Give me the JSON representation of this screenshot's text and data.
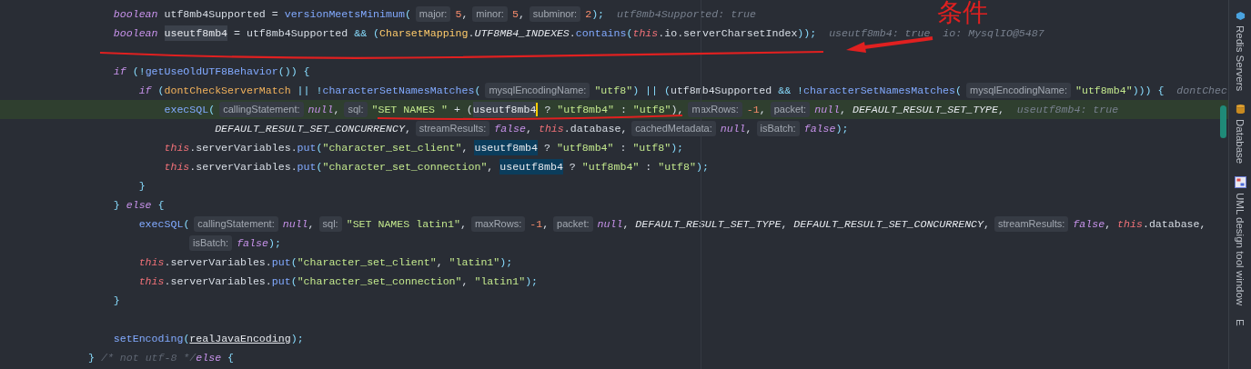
{
  "editor": {
    "lines": [
      {
        "kind": "code",
        "current": false,
        "tokens": [
          {
            "kind": "keyword",
            "text": "    boolean"
          },
          {
            "kind": "ident",
            "text": " utf8mb4Supported = "
          },
          {
            "kind": "method",
            "text": "versionMeetsMinimum"
          },
          {
            "kind": "punct",
            "text": "("
          },
          {
            "kind": "hint",
            "text": "major:"
          },
          {
            "kind": "number",
            "text": "5"
          },
          {
            "kind": "ident",
            "text": ","
          },
          {
            "kind": "hint",
            "text": "minor:"
          },
          {
            "kind": "number",
            "text": "5"
          },
          {
            "kind": "ident",
            "text": ","
          },
          {
            "kind": "hint",
            "text": "subminor:"
          },
          {
            "kind": "number",
            "text": "2"
          },
          {
            "kind": "punct",
            "text": ");"
          },
          {
            "kind": "debug",
            "text": "  utf8mb4Supported: true"
          }
        ]
      },
      {
        "kind": "code",
        "current": false,
        "tokens": [
          {
            "kind": "keyword",
            "text": "    boolean "
          },
          {
            "kind": "usage",
            "text": "useutf8mb4"
          },
          {
            "kind": "ident",
            "text": " = utf8mb4Supported "
          },
          {
            "kind": "operator",
            "text": "&&"
          },
          {
            "kind": "punct",
            "text": " ("
          },
          {
            "kind": "class",
            "text": "CharsetMapping"
          },
          {
            "kind": "ident",
            "text": "."
          },
          {
            "kind": "constant",
            "text": "UTF8MB4_INDEXES"
          },
          {
            "kind": "ident",
            "text": "."
          },
          {
            "kind": "method",
            "text": "contains"
          },
          {
            "kind": "punct",
            "text": "("
          },
          {
            "kind": "this",
            "text": "this"
          },
          {
            "kind": "ident",
            "text": ".io.serverCharsetIndex"
          },
          {
            "kind": "punct",
            "text": "));"
          },
          {
            "kind": "debug",
            "text": "  useutf8mb4: true  io: MysqlIO@5487"
          }
        ]
      },
      {
        "kind": "blank",
        "current": false
      },
      {
        "kind": "code",
        "current": false,
        "tokens": [
          {
            "kind": "keyword",
            "text": "    if"
          },
          {
            "kind": "punct",
            "text": " (!"
          },
          {
            "kind": "method",
            "text": "getUseOldUTF8Behavior"
          },
          {
            "kind": "punct",
            "text": "()) {"
          }
        ]
      },
      {
        "kind": "code",
        "current": false,
        "tokens": [
          {
            "kind": "keyword",
            "text": "        if"
          },
          {
            "kind": "punct",
            "text": " ("
          },
          {
            "kind": "field",
            "text": "dontCheckServerMatch"
          },
          {
            "kind": "operator",
            "text": " || !"
          },
          {
            "kind": "method",
            "text": "characterSetNamesMatches"
          },
          {
            "kind": "punct",
            "text": "("
          },
          {
            "kind": "hint",
            "text": "mysqlEncodingName:"
          },
          {
            "kind": "string",
            "text": "\"utf8\""
          },
          {
            "kind": "punct",
            "text": ") "
          },
          {
            "kind": "operator",
            "text": "||"
          },
          {
            "kind": "punct",
            "text": " ("
          },
          {
            "kind": "ident",
            "text": "utf8mb4Supported "
          },
          {
            "kind": "operator",
            "text": "&& !"
          },
          {
            "kind": "method",
            "text": "characterSetNamesMatches"
          },
          {
            "kind": "punct",
            "text": "("
          },
          {
            "kind": "hint",
            "text": "mysqlEncodingName:"
          },
          {
            "kind": "string",
            "text": "\"utf8mb4\""
          },
          {
            "kind": "punct",
            "text": "))) {"
          },
          {
            "kind": "debug",
            "text": "  dontChec"
          }
        ]
      },
      {
        "kind": "code",
        "current": true,
        "tokens": [
          {
            "kind": "method",
            "text": "            execSQL"
          },
          {
            "kind": "punct",
            "text": "("
          },
          {
            "kind": "hint",
            "text": "callingStatement:"
          },
          {
            "kind": "keyword",
            "text": "null"
          },
          {
            "kind": "ident",
            "text": ","
          },
          {
            "kind": "hint",
            "text": "sql:"
          },
          {
            "kind": "string",
            "text": "\"SET NAMES \""
          },
          {
            "kind": "ident",
            "text": " + ("
          },
          {
            "kind": "usage",
            "text": "useutf8mb4"
          },
          {
            "kind": "caret"
          },
          {
            "kind": "ident",
            "text": " ? "
          },
          {
            "kind": "string",
            "text": "\"utf8mb4\""
          },
          {
            "kind": "ident",
            "text": " : "
          },
          {
            "kind": "string",
            "text": "\"utf8\""
          },
          {
            "kind": "ident",
            "text": "),"
          },
          {
            "kind": "hint",
            "text": "maxRows:"
          },
          {
            "kind": "number",
            "text": "-1"
          },
          {
            "kind": "ident",
            "text": ","
          },
          {
            "kind": "hint",
            "text": "packet:"
          },
          {
            "kind": "keyword",
            "text": "null"
          },
          {
            "kind": "ident",
            "text": ", "
          },
          {
            "kind": "constant",
            "text": "DEFAULT_RESULT_SET_TYPE"
          },
          {
            "kind": "ident",
            "text": ","
          },
          {
            "kind": "debug",
            "text": "  useutf8mb4: true"
          }
        ]
      },
      {
        "kind": "code",
        "current": false,
        "tokens": [
          {
            "kind": "constant",
            "text": "                    DEFAULT_RESULT_SET_CONCURRENCY"
          },
          {
            "kind": "ident",
            "text": ","
          },
          {
            "kind": "hint",
            "text": "streamResults:"
          },
          {
            "kind": "keyword",
            "text": "false"
          },
          {
            "kind": "ident",
            "text": ", "
          },
          {
            "kind": "this",
            "text": "this"
          },
          {
            "kind": "ident",
            "text": ".database,"
          },
          {
            "kind": "hint",
            "text": "cachedMetadata:"
          },
          {
            "kind": "keyword",
            "text": "null"
          },
          {
            "kind": "ident",
            "text": ","
          },
          {
            "kind": "hint",
            "text": "isBatch:"
          },
          {
            "kind": "keyword",
            "text": "false"
          },
          {
            "kind": "punct",
            "text": ");"
          }
        ]
      },
      {
        "kind": "code",
        "current": false,
        "tokens": [
          {
            "kind": "this",
            "text": "            this"
          },
          {
            "kind": "ident",
            "text": ".serverVariables."
          },
          {
            "kind": "method",
            "text": "put"
          },
          {
            "kind": "punct",
            "text": "("
          },
          {
            "kind": "string",
            "text": "\"character_set_client\""
          },
          {
            "kind": "ident",
            "text": ", "
          },
          {
            "kind": "write",
            "text": "useutf8mb4"
          },
          {
            "kind": "ident",
            "text": " ? "
          },
          {
            "kind": "string",
            "text": "\"utf8mb4\""
          },
          {
            "kind": "ident",
            "text": " : "
          },
          {
            "kind": "string",
            "text": "\"utf8\""
          },
          {
            "kind": "punct",
            "text": ");"
          }
        ]
      },
      {
        "kind": "code",
        "current": false,
        "tokens": [
          {
            "kind": "this",
            "text": "            this"
          },
          {
            "kind": "ident",
            "text": ".serverVariables."
          },
          {
            "kind": "method",
            "text": "put"
          },
          {
            "kind": "punct",
            "text": "("
          },
          {
            "kind": "string",
            "text": "\"character_set_connection\""
          },
          {
            "kind": "ident",
            "text": ", "
          },
          {
            "kind": "write",
            "text": "useutf8mb4"
          },
          {
            "kind": "ident",
            "text": " ? "
          },
          {
            "kind": "string",
            "text": "\"utf8mb4\""
          },
          {
            "kind": "ident",
            "text": " : "
          },
          {
            "kind": "string",
            "text": "\"utf8\""
          },
          {
            "kind": "punct",
            "text": ");"
          }
        ]
      },
      {
        "kind": "code",
        "current": false,
        "tokens": [
          {
            "kind": "punct",
            "text": "        }"
          }
        ]
      },
      {
        "kind": "code",
        "current": false,
        "tokens": [
          {
            "kind": "punct",
            "text": "    } "
          },
          {
            "kind": "keyword",
            "text": "else"
          },
          {
            "kind": "punct",
            "text": " {"
          }
        ]
      },
      {
        "kind": "code",
        "current": false,
        "tokens": [
          {
            "kind": "method",
            "text": "        execSQL"
          },
          {
            "kind": "punct",
            "text": "("
          },
          {
            "kind": "hint",
            "text": "callingStatement:"
          },
          {
            "kind": "keyword",
            "text": "null"
          },
          {
            "kind": "ident",
            "text": ","
          },
          {
            "kind": "hint",
            "text": "sql:"
          },
          {
            "kind": "string",
            "text": "\"SET NAMES latin1\""
          },
          {
            "kind": "ident",
            "text": ","
          },
          {
            "kind": "hint",
            "text": "maxRows:"
          },
          {
            "kind": "number",
            "text": "-1"
          },
          {
            "kind": "ident",
            "text": ","
          },
          {
            "kind": "hint",
            "text": "packet:"
          },
          {
            "kind": "keyword",
            "text": "null"
          },
          {
            "kind": "ident",
            "text": ", "
          },
          {
            "kind": "constant",
            "text": "DEFAULT_RESULT_SET_TYPE"
          },
          {
            "kind": "ident",
            "text": ", "
          },
          {
            "kind": "constant",
            "text": "DEFAULT_RESULT_SET_CONCURRENCY"
          },
          {
            "kind": "ident",
            "text": ","
          },
          {
            "kind": "hint",
            "text": "streamResults:"
          },
          {
            "kind": "keyword",
            "text": "false"
          },
          {
            "kind": "ident",
            "text": ", "
          },
          {
            "kind": "this",
            "text": "this"
          },
          {
            "kind": "ident",
            "text": ".database,"
          }
        ]
      },
      {
        "kind": "code",
        "current": false,
        "tokens": [
          {
            "kind": "indent"
          },
          {
            "kind": "hint",
            "text": "isBatch:"
          },
          {
            "kind": "keyword",
            "text": "false"
          },
          {
            "kind": "punct",
            "text": ");"
          }
        ]
      },
      {
        "kind": "code",
        "current": false,
        "tokens": [
          {
            "kind": "this",
            "text": "        this"
          },
          {
            "kind": "ident",
            "text": ".serverVariables."
          },
          {
            "kind": "method",
            "text": "put"
          },
          {
            "kind": "punct",
            "text": "("
          },
          {
            "kind": "string",
            "text": "\"character_set_client\""
          },
          {
            "kind": "ident",
            "text": ", "
          },
          {
            "kind": "string",
            "text": "\"latin1\""
          },
          {
            "kind": "punct",
            "text": ");"
          }
        ]
      },
      {
        "kind": "code",
        "current": false,
        "tokens": [
          {
            "kind": "this",
            "text": "        this"
          },
          {
            "kind": "ident",
            "text": ".serverVariables."
          },
          {
            "kind": "method",
            "text": "put"
          },
          {
            "kind": "punct",
            "text": "("
          },
          {
            "kind": "string",
            "text": "\"character_set_connection\""
          },
          {
            "kind": "ident",
            "text": ", "
          },
          {
            "kind": "string",
            "text": "\"latin1\""
          },
          {
            "kind": "punct",
            "text": ");"
          }
        ]
      },
      {
        "kind": "code",
        "current": false,
        "tokens": [
          {
            "kind": "punct",
            "text": "    }"
          }
        ]
      },
      {
        "kind": "blank",
        "current": false
      },
      {
        "kind": "code",
        "current": false,
        "tokens": [
          {
            "kind": "method",
            "text": "    setEncoding"
          },
          {
            "kind": "punct",
            "text": "("
          },
          {
            "kind": "underlined",
            "text": "realJavaEncoding"
          },
          {
            "kind": "punct",
            "text": ");"
          }
        ]
      },
      {
        "kind": "code",
        "current": false,
        "tokens": [
          {
            "kind": "punct",
            "text": "}"
          },
          {
            "kind": "comment",
            "text": " /* not utf-8 */"
          },
          {
            "kind": "keyword",
            "text": "else"
          },
          {
            "kind": "punct",
            "text": " {"
          }
        ]
      }
    ]
  },
  "annotation": {
    "label": "条件"
  },
  "tool_windows": [
    {
      "kind": "redis",
      "label": "Redis Servers"
    },
    {
      "kind": "database",
      "label": "Database"
    },
    {
      "kind": "uml",
      "label": "UML design tool window"
    },
    {
      "kind": "other",
      "label": "E"
    }
  ]
}
